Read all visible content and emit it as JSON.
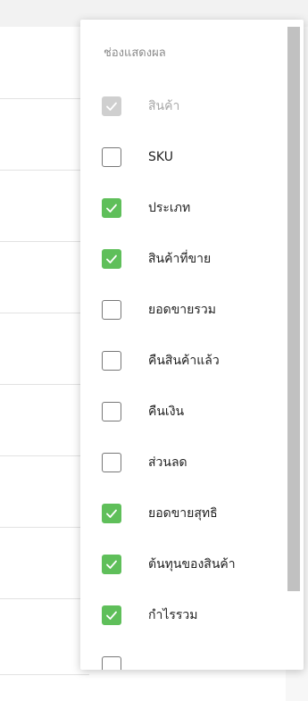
{
  "panel": {
    "title": "ช่องแสดงผล",
    "items": [
      {
        "label": "สินค้า",
        "checked": true,
        "disabled": true
      },
      {
        "label": "SKU",
        "checked": false,
        "disabled": false
      },
      {
        "label": "ประเภท",
        "checked": true,
        "disabled": false
      },
      {
        "label": "สินค้าที่ขาย",
        "checked": true,
        "disabled": false
      },
      {
        "label": "ยอดขายรวม",
        "checked": false,
        "disabled": false
      },
      {
        "label": "คืนสินค้าแล้ว",
        "checked": false,
        "disabled": false
      },
      {
        "label": "คืนเงิน",
        "checked": false,
        "disabled": false
      },
      {
        "label": "ส่วนลด",
        "checked": false,
        "disabled": false
      },
      {
        "label": "ยอดขายสุทธิ",
        "checked": true,
        "disabled": false
      },
      {
        "label": "ต้นทุนของสินค้า",
        "checked": true,
        "disabled": false
      },
      {
        "label": "กำไรรวม",
        "checked": true,
        "disabled": false
      },
      {
        "label": "",
        "checked": false,
        "disabled": false
      }
    ]
  },
  "colors": {
    "check_green": "#5fbf5a",
    "disabled_gray": "#cfcfcf",
    "title_gray": "#8a8a8a"
  }
}
